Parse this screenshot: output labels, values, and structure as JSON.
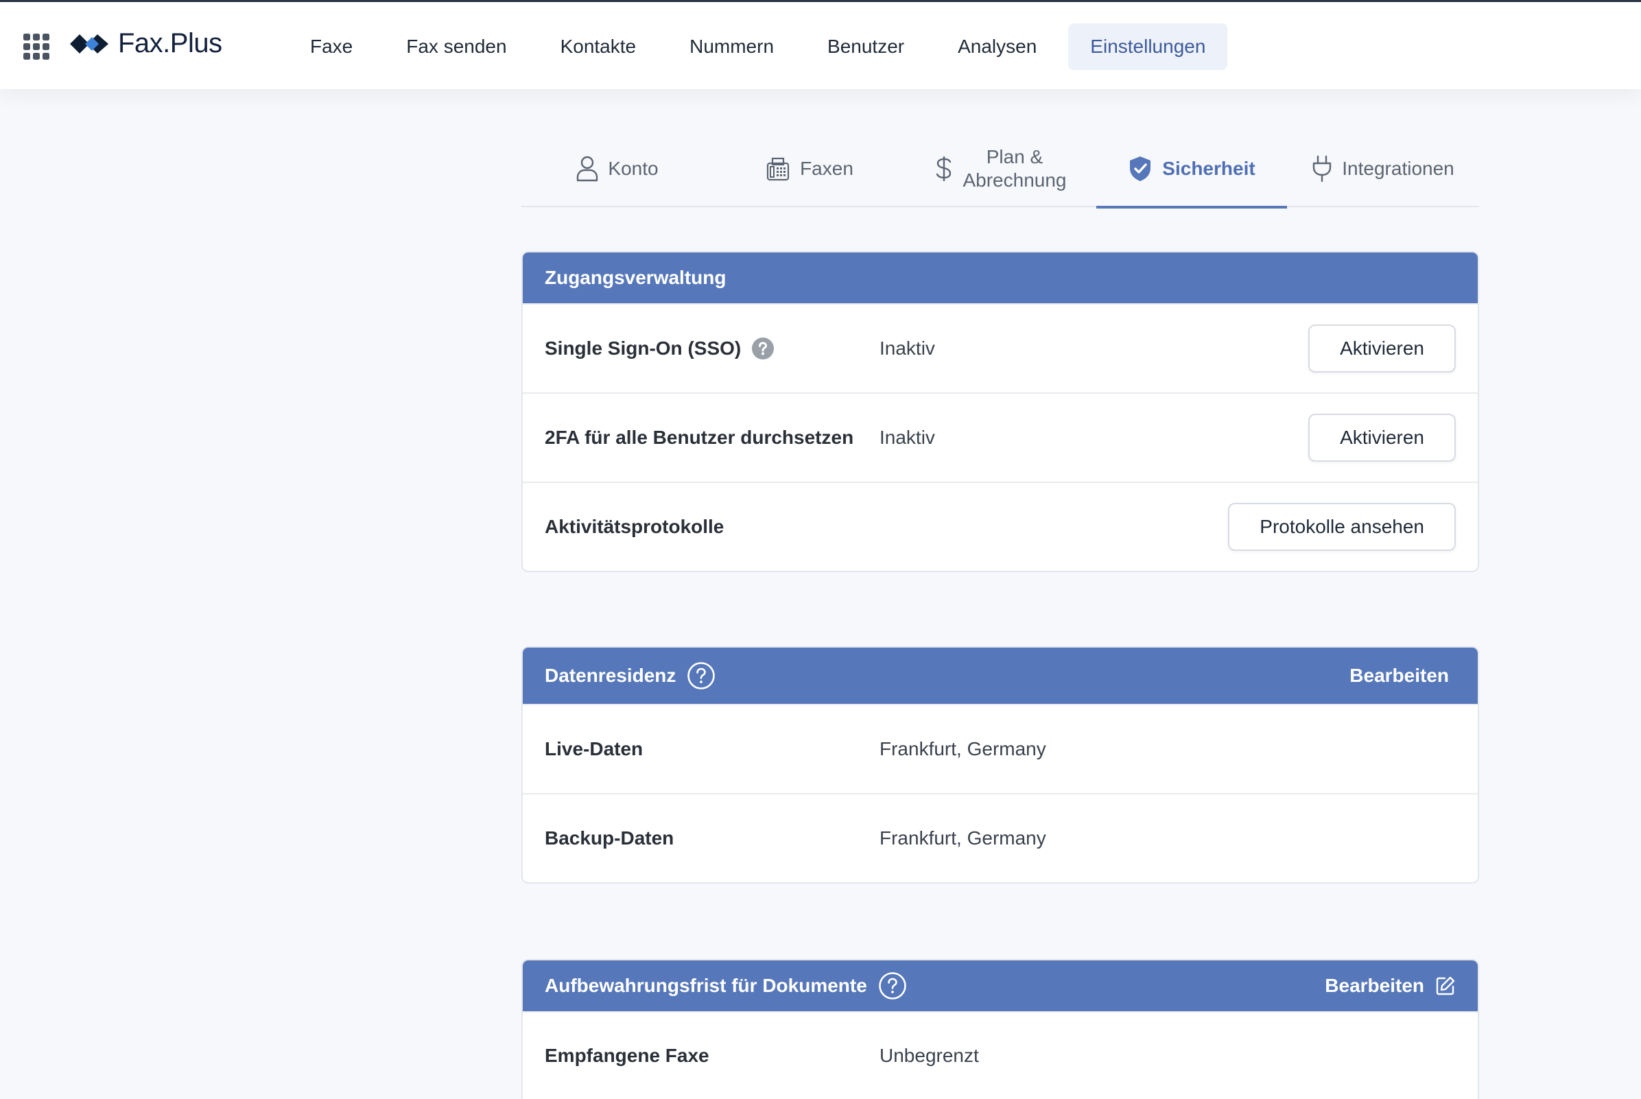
{
  "app": {
    "name": "Fax.Plus",
    "brand_color": "#5677b9"
  },
  "nav": {
    "items": [
      {
        "label": "Faxe"
      },
      {
        "label": "Fax senden"
      },
      {
        "label": "Kontakte"
      },
      {
        "label": "Nummern"
      },
      {
        "label": "Benutzer"
      },
      {
        "label": "Analysen"
      },
      {
        "label": "Einstellungen",
        "active": true
      }
    ]
  },
  "subtabs": {
    "konto": "Konto",
    "faxen": "Faxen",
    "plan_line1": "Plan &",
    "plan_line2": "Abrechnung",
    "sicherheit": "Sicherheit",
    "integrationen": "Integrationen"
  },
  "access": {
    "title": "Zugangsverwaltung",
    "rows": [
      {
        "label": "Single Sign-On (SSO)",
        "value": "Inaktiv",
        "button": "Aktivieren"
      },
      {
        "label": "2FA für alle Benutzer durchsetzen",
        "value": "Inaktiv",
        "button": "Aktivieren"
      },
      {
        "label": "Aktivitätsprotokolle",
        "value": "",
        "button": "Protokolle ansehen"
      }
    ]
  },
  "residency": {
    "title": "Datenresidenz",
    "edit_label": "Bearbeiten",
    "rows": [
      {
        "label": "Live-Daten",
        "value": "Frankfurt, Germany"
      },
      {
        "label": "Backup-Daten",
        "value": "Frankfurt, Germany"
      }
    ]
  },
  "retention": {
    "title": "Aufbewahrungsfrist für Dokumente",
    "edit_label": "Bearbeiten",
    "rows": [
      {
        "label": "Empfangene Faxe",
        "value": "Unbegrenzt"
      }
    ]
  },
  "icons": {
    "apps": "grid-icon",
    "konto": "user-icon",
    "faxen": "fax-icon",
    "plan": "dollar-icon",
    "sicherheit": "shield-check-icon",
    "integrationen": "plug-icon",
    "help": "question-circle-icon",
    "edit": "edit-icon"
  }
}
